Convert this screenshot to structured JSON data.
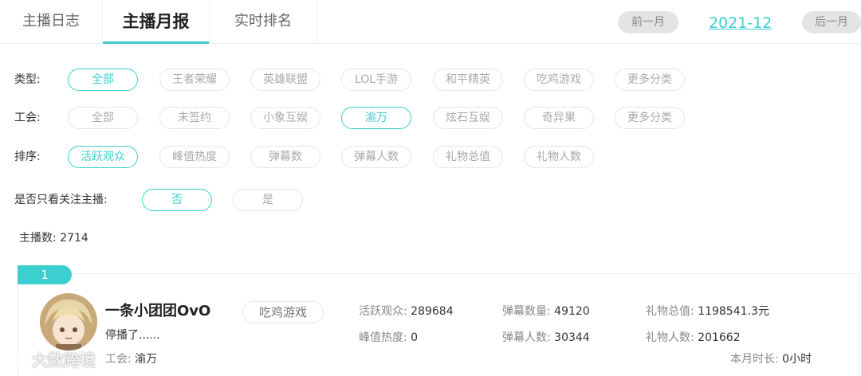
{
  "tabs": [
    {
      "label": "主播日志"
    },
    {
      "label": "主播月报"
    },
    {
      "label": "实时排名"
    }
  ],
  "month_nav": {
    "prev_label": "前一月",
    "current": "2021-12",
    "next_label": "后一月"
  },
  "filters": {
    "type": {
      "label": "类型:",
      "options": [
        "全部",
        "王者荣耀",
        "英雄联盟",
        "LOL手游",
        "和平精英",
        "吃鸡游戏",
        "更多分类"
      ],
      "selected": "全部"
    },
    "guild": {
      "label": "工会:",
      "options": [
        "全部",
        "未签约",
        "小象互娱",
        "渝万",
        "炫石互娱",
        "奇异果",
        "更多分类"
      ],
      "selected": "渝万"
    },
    "sort": {
      "label": "排序:",
      "options": [
        "活跃观众",
        "峰值热度",
        "弹幕数",
        "弹幕人数",
        "礼物总值",
        "礼物人数"
      ],
      "selected": "活跃观众"
    },
    "follow_only": {
      "label": "是否只看关注主播:",
      "options": [
        "否",
        "是"
      ],
      "selected": "否"
    }
  },
  "anchor_count": {
    "label": "主播数:",
    "value": "2714"
  },
  "card": {
    "rank": "1",
    "name": "一条小团团OvO",
    "game": "吃鸡游戏",
    "status": "停播了......",
    "guild_label": "工会:",
    "guild_value": "渝万",
    "stats": {
      "active_viewers": {
        "label": "活跃观众:",
        "value": "289684"
      },
      "peak_heat": {
        "label": "峰值热度:",
        "value": "0"
      },
      "danmaku_count": {
        "label": "弹幕数量:",
        "value": "49120"
      },
      "danmaku_users": {
        "label": "弹幕人数:",
        "value": "30344"
      },
      "gift_total": {
        "label": "礼物总值:",
        "value": "1198541.3元"
      },
      "gift_users": {
        "label": "礼物人数:",
        "value": "201662"
      },
      "month_duration": {
        "label": "本月时长:",
        "value": "0小时"
      }
    }
  },
  "watermark": "大数跨境",
  "colors": {
    "accent": "#3ccfcf",
    "pill_border": "#e6e6e6",
    "muted": "#aaaaaa",
    "nav_btn_bg": "#e4e4e4"
  }
}
